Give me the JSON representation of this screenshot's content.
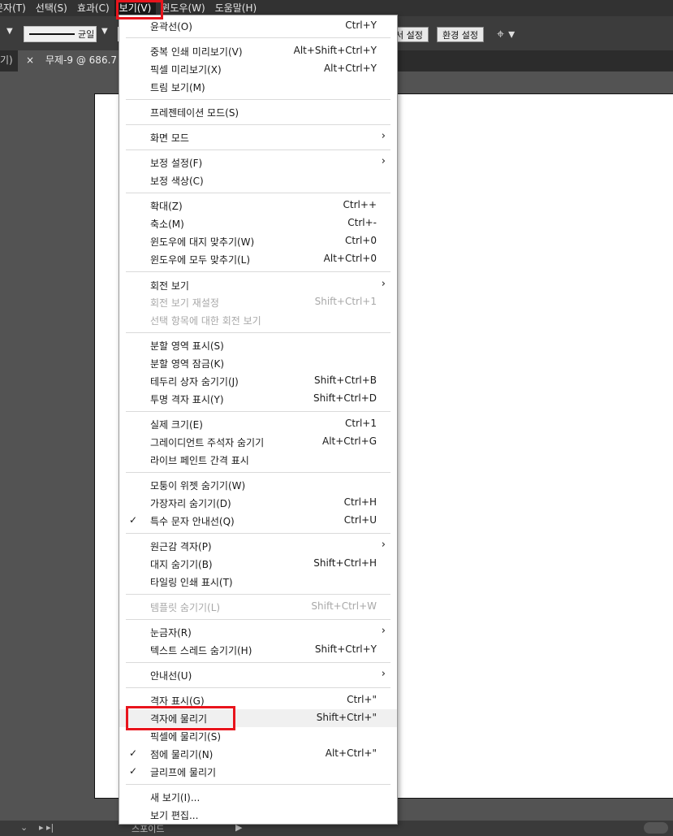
{
  "menubar": {
    "items": [
      {
        "label": "문자(T)"
      },
      {
        "label": "선택(S)"
      },
      {
        "label": "효과(C)"
      },
      {
        "label": "보기(V)"
      },
      {
        "label": "윈도우(W)"
      },
      {
        "label": "도움말(H)"
      }
    ]
  },
  "control": {
    "stroke_label": "균일",
    "doc_setup_label": "서 설정",
    "prefs_label": "환경 설정"
  },
  "tabs": {
    "prev_label": "기)",
    "active_label": "무제-9 @ 686.7",
    "close_glyph": "×"
  },
  "statusbar": {
    "label": "스포이드"
  },
  "menu": {
    "items": [
      {
        "label": "윤곽선(O)",
        "shortcut": "Ctrl+Y"
      },
      {
        "label": "중복 인쇄 미리보기(V)",
        "shortcut": "Alt+Shift+Ctrl+Y"
      },
      {
        "label": "픽셀 미리보기(X)",
        "shortcut": "Alt+Ctrl+Y"
      },
      {
        "label": "트림 보기(M)",
        "shortcut": ""
      },
      {
        "label": "프레젠테이션 모드(S)",
        "shortcut": ""
      },
      {
        "label": "화면 모드",
        "shortcut": ""
      },
      {
        "label": "보정 설정(F)",
        "shortcut": ""
      },
      {
        "label": "보정 색상(C)",
        "shortcut": ""
      },
      {
        "label": "확대(Z)",
        "shortcut": "Ctrl++"
      },
      {
        "label": "축소(M)",
        "shortcut": "Ctrl+-"
      },
      {
        "label": "윈도우에 대지 맞추기(W)",
        "shortcut": "Ctrl+0"
      },
      {
        "label": "윈도우에 모두 맞추기(L)",
        "shortcut": "Alt+Ctrl+0"
      },
      {
        "label": "회전 보기",
        "shortcut": ""
      },
      {
        "label": "회전 보기 재설정",
        "shortcut": "Shift+Ctrl+1"
      },
      {
        "label": "선택 항목에 대한 회전 보기",
        "shortcut": ""
      },
      {
        "label": "분할 영역 표시(S)",
        "shortcut": ""
      },
      {
        "label": "분할 영역 잠금(K)",
        "shortcut": ""
      },
      {
        "label": "테두리 상자 숨기기(J)",
        "shortcut": "Shift+Ctrl+B"
      },
      {
        "label": "투명 격자 표시(Y)",
        "shortcut": "Shift+Ctrl+D"
      },
      {
        "label": "실제 크기(E)",
        "shortcut": "Ctrl+1"
      },
      {
        "label": "그레이디언트 주석자 숨기기",
        "shortcut": "Alt+Ctrl+G"
      },
      {
        "label": "라이브 페인트 간격 표시",
        "shortcut": ""
      },
      {
        "label": "모퉁이 위젯 숨기기(W)",
        "shortcut": ""
      },
      {
        "label": "가장자리 숨기기(D)",
        "shortcut": "Ctrl+H"
      },
      {
        "label": "특수 문자 안내선(Q)",
        "shortcut": "Ctrl+U"
      },
      {
        "label": "원근감 격자(P)",
        "shortcut": ""
      },
      {
        "label": "대지 숨기기(B)",
        "shortcut": "Shift+Ctrl+H"
      },
      {
        "label": "타일링 인쇄 표시(T)",
        "shortcut": ""
      },
      {
        "label": "템플릿 숨기기(L)",
        "shortcut": "Shift+Ctrl+W"
      },
      {
        "label": "눈금자(R)",
        "shortcut": ""
      },
      {
        "label": "텍스트 스레드 숨기기(H)",
        "shortcut": "Shift+Ctrl+Y"
      },
      {
        "label": "안내선(U)",
        "shortcut": ""
      },
      {
        "label": "격자 표시(G)",
        "shortcut": "Ctrl+\""
      },
      {
        "label": "격자에 물리기",
        "shortcut": "Shift+Ctrl+\""
      },
      {
        "label": "픽셀에 물리기(S)",
        "shortcut": ""
      },
      {
        "label": "점에 물리기(N)",
        "shortcut": "Alt+Ctrl+\""
      },
      {
        "label": "글리프에 물리기",
        "shortcut": ""
      },
      {
        "label": "새 보기(I)...",
        "shortcut": ""
      },
      {
        "label": "보기 편집...",
        "shortcut": ""
      }
    ]
  }
}
